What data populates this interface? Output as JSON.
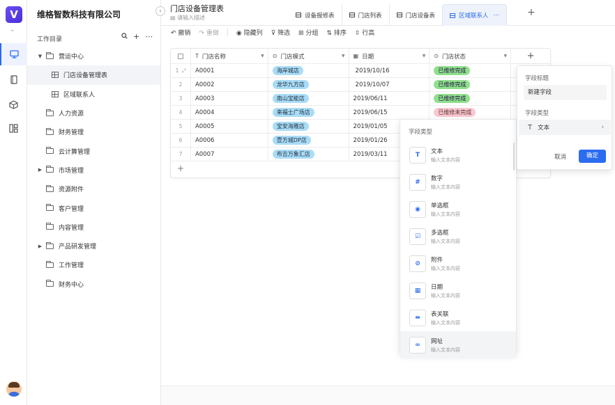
{
  "app": {
    "logo_letter": "V",
    "company": "维格智数科技有限公司"
  },
  "sidebar": {
    "dir_title": "工作目录",
    "tree": [
      {
        "label": "营运中心",
        "type": "folder",
        "arrow": "▼",
        "indent": 0
      },
      {
        "label": "门店设备管理表",
        "type": "table",
        "arrow": "",
        "indent": 1,
        "active": true
      },
      {
        "label": "区域联系人",
        "type": "table",
        "arrow": "",
        "indent": 1
      },
      {
        "label": "人力资源",
        "type": "folder",
        "arrow": "",
        "indent": 0
      },
      {
        "label": "财务管理",
        "type": "folder",
        "arrow": "",
        "indent": 0
      },
      {
        "label": "云计算管理",
        "type": "folder",
        "arrow": "",
        "indent": 0
      },
      {
        "label": "市场管理",
        "type": "folder",
        "arrow": "▶",
        "indent": 0
      },
      {
        "label": "资源附件",
        "type": "folder",
        "arrow": "",
        "indent": 0
      },
      {
        "label": "客户管理",
        "type": "folder",
        "arrow": "",
        "indent": 0
      },
      {
        "label": "内容管理",
        "type": "folder",
        "arrow": "",
        "indent": 0
      },
      {
        "label": "产品研发管理",
        "type": "folder",
        "arrow": "▶",
        "indent": 0
      },
      {
        "label": "工作管理",
        "type": "folder",
        "arrow": "",
        "indent": 0
      },
      {
        "label": "财务中心",
        "type": "folder",
        "arrow": "",
        "indent": 0
      }
    ]
  },
  "header": {
    "title": "门店设备管理表",
    "description_placeholder": "请输入描述",
    "tabs": [
      {
        "label": "设备报修表",
        "active": false
      },
      {
        "label": "门店列表",
        "active": false
      },
      {
        "label": "门店设备表",
        "active": false
      },
      {
        "label": "区域联系人",
        "active": true
      }
    ]
  },
  "toolbar": {
    "undo": "撤销",
    "redo": "重做",
    "hide_cols": "隐藏列",
    "filter": "筛选",
    "group": "分组",
    "sort": "排序",
    "row_height": "行高"
  },
  "grid": {
    "columns": [
      "门店名称",
      "门店模式",
      "日期",
      "门店状态"
    ],
    "rows": [
      {
        "num": "1",
        "name": "A0001",
        "mode": "海岸城店",
        "date": "2019/10/16",
        "status": "已维修完成",
        "status_color": "green"
      },
      {
        "num": "2",
        "name": "A0002",
        "mode": "龙华九方店",
        "date": "2019/10/07",
        "status": "已维修完成",
        "status_color": "green"
      },
      {
        "num": "3",
        "name": "A0003",
        "mode": "南山宝能店",
        "date": "2019/06/11",
        "status": "已维修完成",
        "status_color": "green"
      },
      {
        "num": "4",
        "name": "A0004",
        "mode": "来福士广场店",
        "date": "2019/06/15",
        "status": "已维修未完成",
        "status_color": "pink"
      },
      {
        "num": "5",
        "name": "A0005",
        "mode": "宝安海雅店",
        "date": "2019/01/05",
        "status": "",
        "status_color": ""
      },
      {
        "num": "6",
        "name": "A0006",
        "mode": "壹方城DP店",
        "date": "2019/01/26",
        "status": "",
        "status_color": ""
      },
      {
        "num": "7",
        "name": "A0007",
        "mode": "布吉万象汇店",
        "date": "2019/03/11",
        "status": "",
        "status_color": ""
      }
    ]
  },
  "field_type_menu": {
    "title": "字段类型",
    "items": [
      {
        "label": "文本",
        "sub": "输入文本内容",
        "icon": "text-icon",
        "glyph": "T"
      },
      {
        "label": "数字",
        "sub": "输入文本内容",
        "icon": "number-icon",
        "glyph": "#"
      },
      {
        "label": "单选框",
        "sub": "输入文本内容",
        "icon": "radio-icon",
        "glyph": "◉"
      },
      {
        "label": "多选框",
        "sub": "输入文本内容",
        "icon": "checkbox-icon",
        "glyph": "☑"
      },
      {
        "label": "附件",
        "sub": "输入文本内容",
        "icon": "attachment-icon",
        "glyph": "⊘"
      },
      {
        "label": "日期",
        "sub": "输入文本内容",
        "icon": "date-icon",
        "glyph": "▦"
      },
      {
        "label": "表关联",
        "sub": "输入文本内容",
        "icon": "link-table-icon",
        "glyph": "⇹"
      },
      {
        "label": "网址",
        "sub": "输入文本内容",
        "icon": "url-icon",
        "glyph": "∞"
      }
    ]
  },
  "field_panel": {
    "title_label": "字段标题",
    "title_value": "新建字段",
    "type_label": "字段类型",
    "type_value": "文本",
    "cancel": "取消",
    "confirm": "确定"
  }
}
